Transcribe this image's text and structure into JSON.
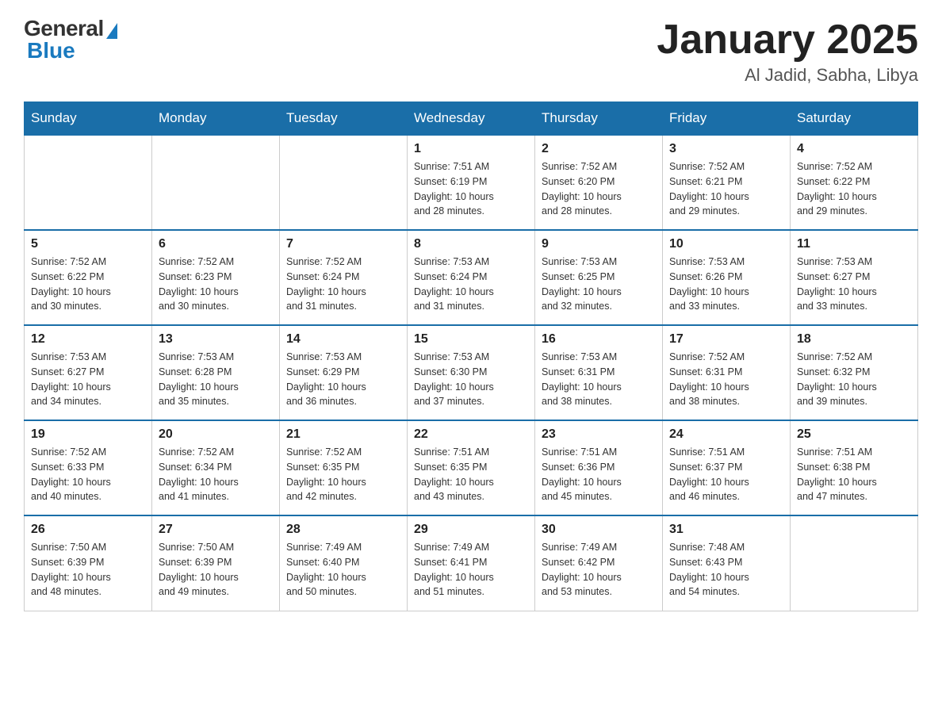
{
  "logo": {
    "general_text": "General",
    "blue_text": "Blue"
  },
  "header": {
    "title": "January 2025",
    "subtitle": "Al Jadid, Sabha, Libya"
  },
  "weekdays": [
    "Sunday",
    "Monday",
    "Tuesday",
    "Wednesday",
    "Thursday",
    "Friday",
    "Saturday"
  ],
  "weeks": [
    [
      {
        "day": "",
        "info": ""
      },
      {
        "day": "",
        "info": ""
      },
      {
        "day": "",
        "info": ""
      },
      {
        "day": "1",
        "info": "Sunrise: 7:51 AM\nSunset: 6:19 PM\nDaylight: 10 hours\nand 28 minutes."
      },
      {
        "day": "2",
        "info": "Sunrise: 7:52 AM\nSunset: 6:20 PM\nDaylight: 10 hours\nand 28 minutes."
      },
      {
        "day": "3",
        "info": "Sunrise: 7:52 AM\nSunset: 6:21 PM\nDaylight: 10 hours\nand 29 minutes."
      },
      {
        "day": "4",
        "info": "Sunrise: 7:52 AM\nSunset: 6:22 PM\nDaylight: 10 hours\nand 29 minutes."
      }
    ],
    [
      {
        "day": "5",
        "info": "Sunrise: 7:52 AM\nSunset: 6:22 PM\nDaylight: 10 hours\nand 30 minutes."
      },
      {
        "day": "6",
        "info": "Sunrise: 7:52 AM\nSunset: 6:23 PM\nDaylight: 10 hours\nand 30 minutes."
      },
      {
        "day": "7",
        "info": "Sunrise: 7:52 AM\nSunset: 6:24 PM\nDaylight: 10 hours\nand 31 minutes."
      },
      {
        "day": "8",
        "info": "Sunrise: 7:53 AM\nSunset: 6:24 PM\nDaylight: 10 hours\nand 31 minutes."
      },
      {
        "day": "9",
        "info": "Sunrise: 7:53 AM\nSunset: 6:25 PM\nDaylight: 10 hours\nand 32 minutes."
      },
      {
        "day": "10",
        "info": "Sunrise: 7:53 AM\nSunset: 6:26 PM\nDaylight: 10 hours\nand 33 minutes."
      },
      {
        "day": "11",
        "info": "Sunrise: 7:53 AM\nSunset: 6:27 PM\nDaylight: 10 hours\nand 33 minutes."
      }
    ],
    [
      {
        "day": "12",
        "info": "Sunrise: 7:53 AM\nSunset: 6:27 PM\nDaylight: 10 hours\nand 34 minutes."
      },
      {
        "day": "13",
        "info": "Sunrise: 7:53 AM\nSunset: 6:28 PM\nDaylight: 10 hours\nand 35 minutes."
      },
      {
        "day": "14",
        "info": "Sunrise: 7:53 AM\nSunset: 6:29 PM\nDaylight: 10 hours\nand 36 minutes."
      },
      {
        "day": "15",
        "info": "Sunrise: 7:53 AM\nSunset: 6:30 PM\nDaylight: 10 hours\nand 37 minutes."
      },
      {
        "day": "16",
        "info": "Sunrise: 7:53 AM\nSunset: 6:31 PM\nDaylight: 10 hours\nand 38 minutes."
      },
      {
        "day": "17",
        "info": "Sunrise: 7:52 AM\nSunset: 6:31 PM\nDaylight: 10 hours\nand 38 minutes."
      },
      {
        "day": "18",
        "info": "Sunrise: 7:52 AM\nSunset: 6:32 PM\nDaylight: 10 hours\nand 39 minutes."
      }
    ],
    [
      {
        "day": "19",
        "info": "Sunrise: 7:52 AM\nSunset: 6:33 PM\nDaylight: 10 hours\nand 40 minutes."
      },
      {
        "day": "20",
        "info": "Sunrise: 7:52 AM\nSunset: 6:34 PM\nDaylight: 10 hours\nand 41 minutes."
      },
      {
        "day": "21",
        "info": "Sunrise: 7:52 AM\nSunset: 6:35 PM\nDaylight: 10 hours\nand 42 minutes."
      },
      {
        "day": "22",
        "info": "Sunrise: 7:51 AM\nSunset: 6:35 PM\nDaylight: 10 hours\nand 43 minutes."
      },
      {
        "day": "23",
        "info": "Sunrise: 7:51 AM\nSunset: 6:36 PM\nDaylight: 10 hours\nand 45 minutes."
      },
      {
        "day": "24",
        "info": "Sunrise: 7:51 AM\nSunset: 6:37 PM\nDaylight: 10 hours\nand 46 minutes."
      },
      {
        "day": "25",
        "info": "Sunrise: 7:51 AM\nSunset: 6:38 PM\nDaylight: 10 hours\nand 47 minutes."
      }
    ],
    [
      {
        "day": "26",
        "info": "Sunrise: 7:50 AM\nSunset: 6:39 PM\nDaylight: 10 hours\nand 48 minutes."
      },
      {
        "day": "27",
        "info": "Sunrise: 7:50 AM\nSunset: 6:39 PM\nDaylight: 10 hours\nand 49 minutes."
      },
      {
        "day": "28",
        "info": "Sunrise: 7:49 AM\nSunset: 6:40 PM\nDaylight: 10 hours\nand 50 minutes."
      },
      {
        "day": "29",
        "info": "Sunrise: 7:49 AM\nSunset: 6:41 PM\nDaylight: 10 hours\nand 51 minutes."
      },
      {
        "day": "30",
        "info": "Sunrise: 7:49 AM\nSunset: 6:42 PM\nDaylight: 10 hours\nand 53 minutes."
      },
      {
        "day": "31",
        "info": "Sunrise: 7:48 AM\nSunset: 6:43 PM\nDaylight: 10 hours\nand 54 minutes."
      },
      {
        "day": "",
        "info": ""
      }
    ]
  ]
}
